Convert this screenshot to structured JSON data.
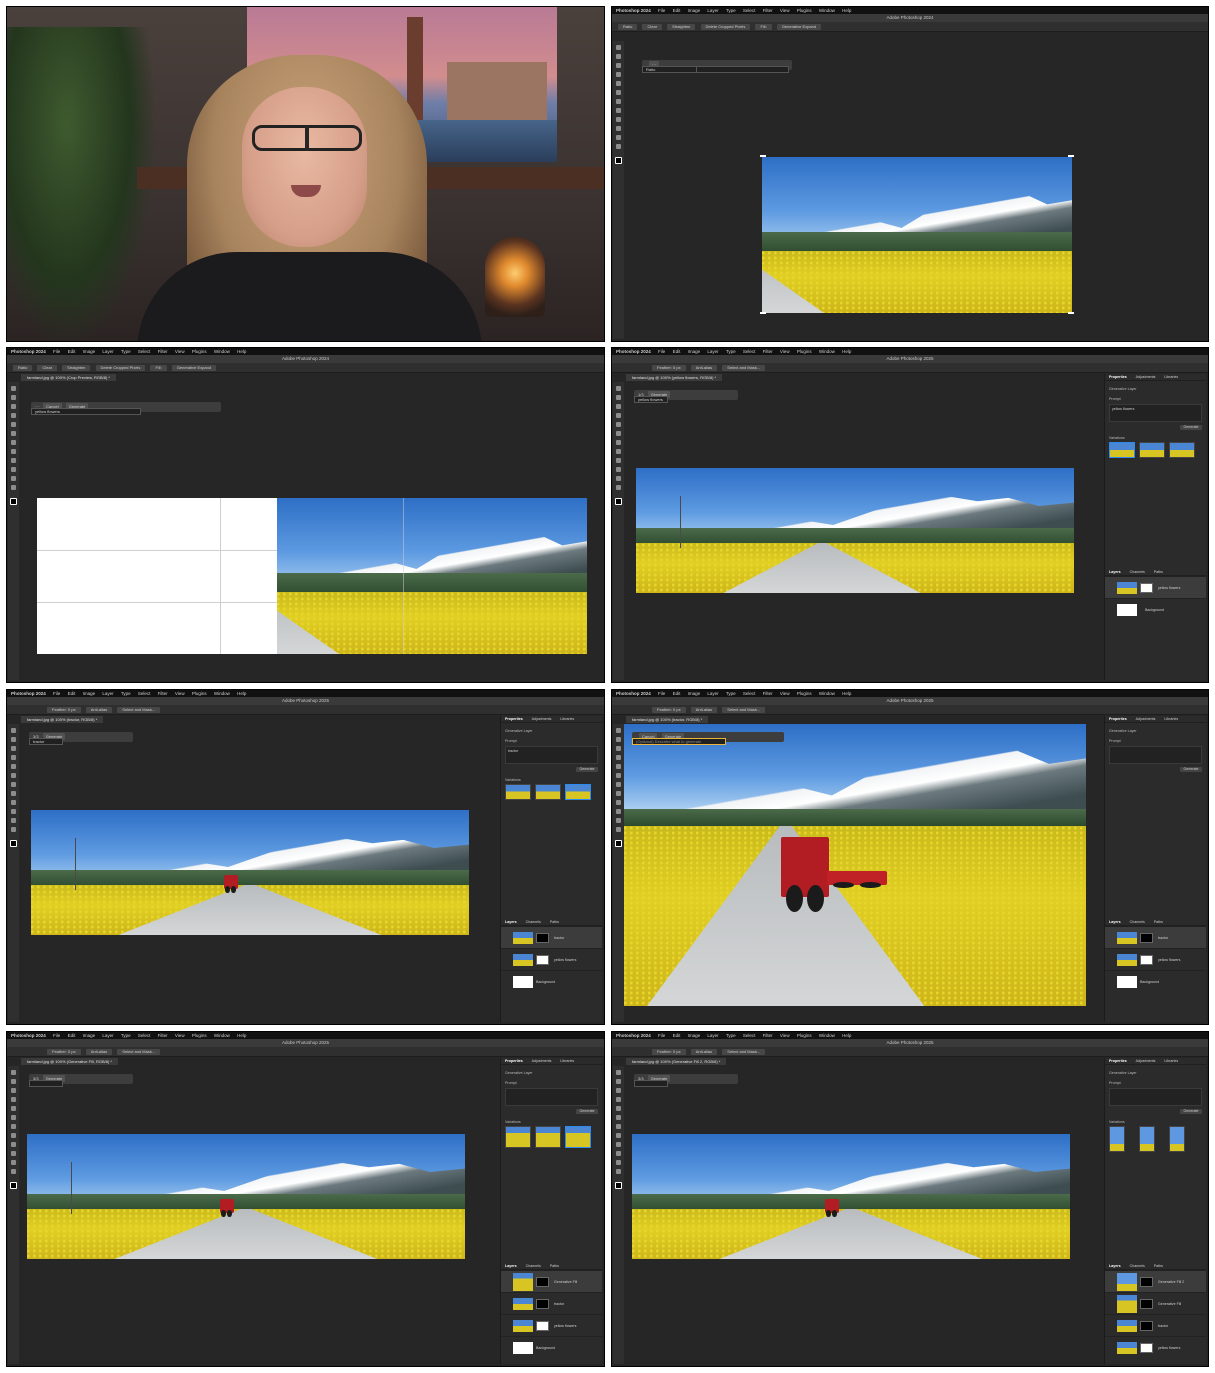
{
  "app": {
    "name": "Photoshop 2024",
    "menus": [
      "File",
      "Edit",
      "Image",
      "Layer",
      "Type",
      "Select",
      "Filter",
      "View",
      "Plugins",
      "Window",
      "Help"
    ],
    "window_title": "Adobe Photoshop 2024",
    "window_title_alt": "Adobe Photoshop 2025"
  },
  "panels": {
    "frame2": {
      "options": [
        "Ratio",
        "Clear",
        "Straighten",
        "Delete Cropped Pixels",
        "Fill:",
        "Generative Expand"
      ],
      "ctx_label": "Generative Expand",
      "ctx_dropdown": "Ratio"
    },
    "frame3": {
      "doc_tab": "farmland.jpg @ 100% (Crop Preview, RGB/8) *",
      "options": [
        "Ratio",
        "Clear",
        "Straighten",
        "Delete Cropped Pixels",
        "Fill:",
        "Generative Expand"
      ],
      "prompt_value": "yellow flowers",
      "cancel": "Cancel",
      "generate": "Generate"
    },
    "frame4": {
      "doc_tab": "farmland.jpg @ 100% (yellow flowers, RGB/8) *",
      "options": [
        "Feather: 0 px",
        "Anti-alias",
        "Select and Mask..."
      ],
      "prompt_value": "yellow flowers",
      "counter": "1/3",
      "generate": "Generate",
      "prompt_text": "yellow flowers",
      "layers": [
        "yellow flowers",
        "Background"
      ]
    },
    "frame5": {
      "doc_tab": "farmland.jpg @ 100% (tractor, RGB/8) *",
      "prompt_value": "tractor",
      "counter": "3/3",
      "generate": "Generate",
      "prompt_text": "tractor",
      "layers": [
        "tractor",
        "yellow flowers",
        "Background"
      ]
    },
    "frame6": {
      "doc_tab": "farmland.jpg @ 100% (tractor, RGB/8) *",
      "placeholder": "(Optional) Describe what to generate",
      "cancel": "Cancel",
      "generate": "Generate",
      "layers": [
        "tractor",
        "yellow flowers",
        "Background"
      ]
    },
    "frame7": {
      "doc_tab": "farmland.jpg @ 100% (Generative Fill, RGB/8) *",
      "counter": "3/3",
      "generate": "Generate",
      "layers": [
        "Generative Fill",
        "tractor",
        "yellow flowers",
        "Background"
      ]
    },
    "frame8": {
      "doc_tab": "farmland.jpg @ 100% (Generative Fill 2, RGB/8) *",
      "counter": "3/3",
      "generate": "Generate",
      "layers": [
        "Generative Fill 2",
        "Generative Fill",
        "tractor",
        "yellow flowers"
      ]
    }
  },
  "properties_panel": {
    "tabs": [
      "Properties",
      "Adjustments",
      "Libraries"
    ],
    "layer_type": "Generative Layer",
    "prompt_label": "Prompt",
    "generate": "Generate",
    "variations": "Variations",
    "layers_tabs": [
      "Layers",
      "Channels",
      "Paths"
    ]
  },
  "colors": {
    "ps_bg": "#262626",
    "ps_panel": "#2b2b2b",
    "accent_blue": "#2d8ceb",
    "highlight": "#e8b43a"
  }
}
